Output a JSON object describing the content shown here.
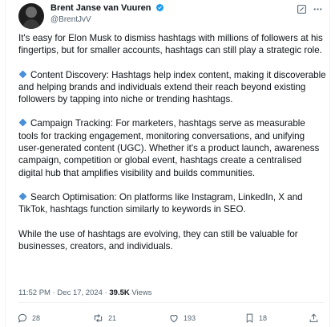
{
  "author": {
    "name": "Brent Janse van Vuuren",
    "handle": "@BrentJvV"
  },
  "post": {
    "paragraphs": [
      {
        "bullet": false,
        "text": "It's easy for Elon Musk to dismiss hashtags with millions of followers at his fingertips, but for smaller accounts, hashtags can still play a strategic role."
      },
      {
        "bullet": true,
        "text": "Content Discovery: Hashtags help index content, making it discoverable and helping brands and individuals extend their reach beyond existing followers by tapping into niche or trending hashtags."
      },
      {
        "bullet": true,
        "text": "Campaign Tracking: For marketers, hashtags serve as measurable tools for tracking engagement, monitoring conversations, and unifying user-generated content (UGC). Whether it's a product launch, awareness campaign, competition or global event, hashtags create a centralised digital hub that amplifies visibility and builds communities."
      },
      {
        "bullet": true,
        "text": "Search Optimisation: On platforms like Instagram, LinkedIn, X and TikTok, hashtags function similarly to keywords in SEO."
      },
      {
        "bullet": false,
        "text": "While the use of hashtags are evolving, they can still be valuable for businesses, creators, and individuals."
      }
    ]
  },
  "meta": {
    "time": "11:52 PM",
    "date": "Dec 17, 2024",
    "separator": "·",
    "views_count": "39.5K",
    "views_label": "Views"
  },
  "actions": {
    "replies": "28",
    "reposts": "21",
    "likes": "193",
    "bookmarks": "18"
  },
  "colors": {
    "verified": "#1d9bf0",
    "bullet": "#4a90d9",
    "muted": "#536471"
  },
  "icons": [
    "verified-badge-icon",
    "grok-icon",
    "more-icon",
    "reply-icon",
    "repost-icon",
    "like-icon",
    "bookmark-icon"
  ]
}
